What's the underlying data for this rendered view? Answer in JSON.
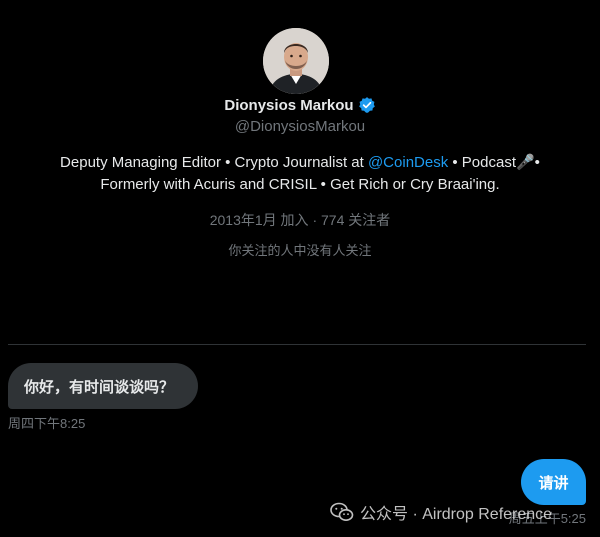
{
  "profile": {
    "display_name": "Dionysios Markou",
    "handle": "@DionysiosMarkou",
    "bio": {
      "line1_before": "Deputy Managing Editor • Crypto Journalist at ",
      "mention": "@CoinDesk",
      "line1_after": " • Podcast🎤•",
      "line2": "Formerly with Acuris and CRISIL • Get Rich or Cry Braai'ing."
    },
    "joined": "2013年1月 加入",
    "separator": " · ",
    "followers": "774 关注者",
    "followers_note": "你关注的人中没有人关注"
  },
  "conversation": {
    "messages": [
      {
        "direction": "incoming",
        "text": "你好，有时间谈谈吗？",
        "time": "周四下午8:25"
      },
      {
        "direction": "outgoing",
        "text": "请讲",
        "time": "周五上午5:25"
      }
    ]
  },
  "watermark": {
    "text": "公众号 · Airdrop Reference"
  },
  "colors": {
    "background": "#000000",
    "accent": "#1d9bf0",
    "incoming_bubble": "#2f3336",
    "muted_text": "#71767b",
    "primary_text": "#e7e9ea"
  },
  "icons": {
    "verified": "verified-badge-icon",
    "watermark": "wechat-icon"
  }
}
